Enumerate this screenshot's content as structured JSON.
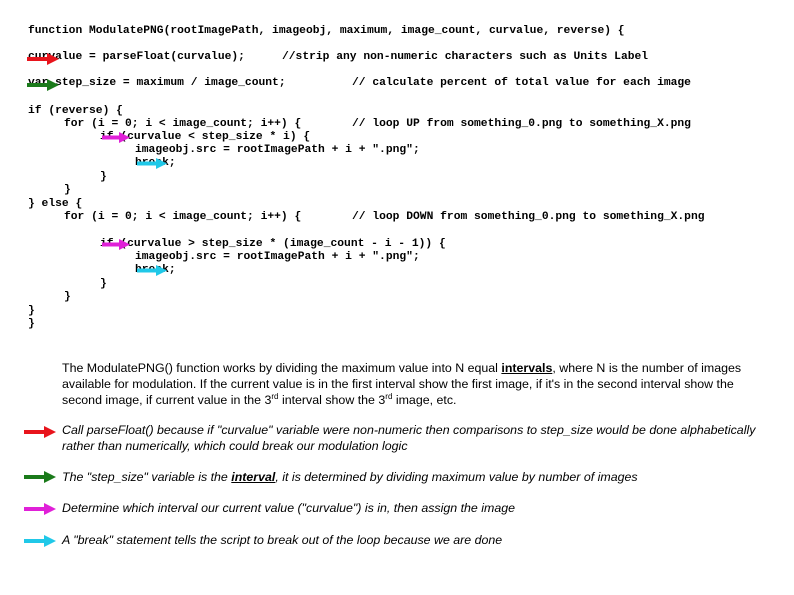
{
  "code": {
    "line_function": "function ModulatePNG(rootImagePath, imageobj, maximum, image_count, curvalue, reverse) {",
    "line_parse": "curvalue = parseFloat(curvalue);",
    "comment_parse": "//strip any non-numeric characters such as Units Label",
    "line_step": "var step_size = maximum / image_count;",
    "comment_step": "// calculate percent of total value for each image",
    "line_if_reverse": "if (reverse) {",
    "line_for_up": "for (i = 0; i < image_count; i++) {",
    "comment_for_up": "// loop UP from something_0.png to something_X.png",
    "line_if_up": "if (curvalue < step_size * i) {",
    "line_src_up": "imageobj.src = rootImagePath + i + \".png\";",
    "line_break_up": "break;",
    "line_close_if_up": "}",
    "line_close_for_up": "}",
    "line_else": "} else {",
    "line_for_down": "for (i = 0; i < image_count; i++) {",
    "comment_for_down": "// loop DOWN from something_0.png to something_X.png",
    "line_if_down": "if (curvalue > step_size * (image_count - i - 1)) {",
    "line_src_down": "imageobj.src = rootImagePath + i + \".png\";",
    "line_break_down": "break;",
    "line_close_if_down": "}",
    "line_close_for_down": "}",
    "line_close_else": "}",
    "line_close_function": "}"
  },
  "explanation": {
    "part1": "The ModulatePNG() function works by dividing the maximum value into N equal ",
    "bold_word": "intervals",
    "part2": ", where N is the number of images available for modulation. If the current value is in the first interval show the first image, if it's in the second interval show the second image, if current value in the 3",
    "sup1": "rd",
    "part3": " interval show the 3",
    "sup2": "rd",
    "part4": " image, etc."
  },
  "notes": [
    {
      "color": "#e8141c",
      "name": "red",
      "text": "Call parseFloat() because if \"curvalue\" variable were non-numeric then comparisons to step_size would be done alphabetically rather than numerically, which could break our modulation logic"
    },
    {
      "color": "#1a7a1a",
      "name": "green",
      "text_before": "The \"step_size\" variable is the ",
      "bold": "interval",
      "text_after": ", it is determined by dividing maximum value by number of images"
    },
    {
      "color": "#e020d8",
      "name": "magenta",
      "text": "Determine which interval our current value (\"curvalue\") is in, then assign the image"
    },
    {
      "color": "#20c8e8",
      "name": "cyan",
      "text": "A \"break\" statement tells the script to break out of the loop because we are done"
    }
  ],
  "colors": {
    "red": "#e8141c",
    "green": "#1a7a1a",
    "magenta": "#e020d8",
    "cyan": "#20c8e8"
  }
}
